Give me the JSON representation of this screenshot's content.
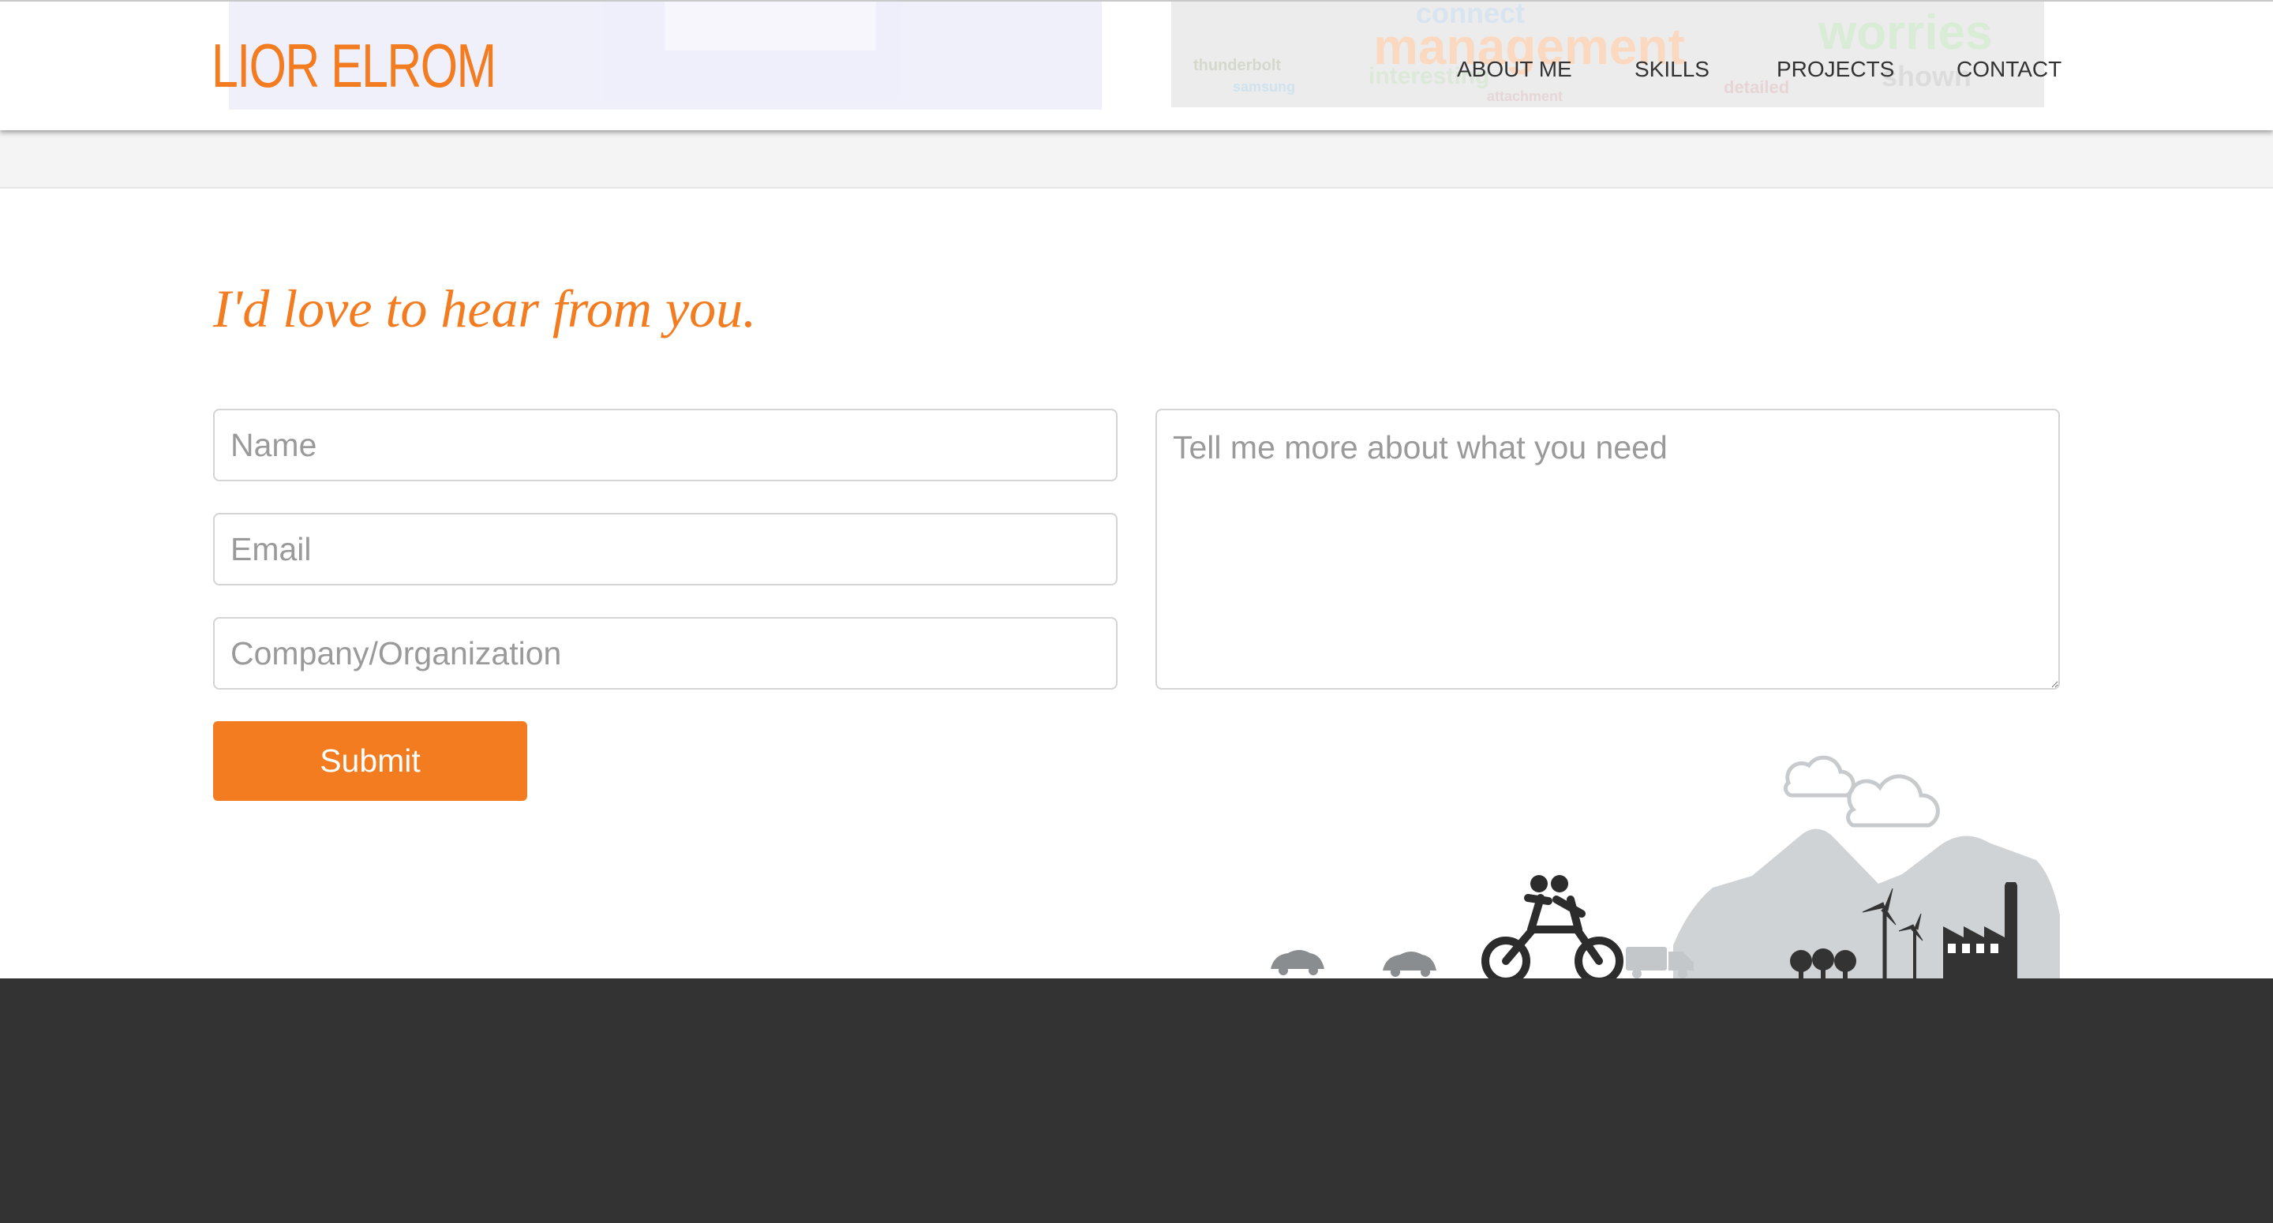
{
  "header": {
    "brand": "LIOR ELROM",
    "nav": [
      "ABOUT ME",
      "SKILLS",
      "PROJECTS",
      "CONTACT"
    ]
  },
  "contact": {
    "heading": "I'd love to hear from you.",
    "name_placeholder": "Name",
    "email_placeholder": "Email",
    "company_placeholder": "Company/Organization",
    "message_placeholder": "Tell me more about what you need",
    "submit_label": "Submit"
  },
  "background_project": {
    "word_cloud": [
      "management",
      "worries",
      "connect",
      "thunderbolt",
      "samsung",
      "interesting",
      "attachment",
      "detailed",
      "shown"
    ]
  },
  "colors": {
    "accent": "#f47c20",
    "footer": "#333333",
    "band": "#f4f4f4",
    "illustration": "#333333",
    "mountain": "#d0d3d6"
  },
  "icons": [
    "cloud-icon",
    "car-icon",
    "tandem-bike-icon",
    "truck-icon",
    "tree-icon",
    "wind-turbine-icon",
    "factory-icon",
    "mountain-icon"
  ]
}
